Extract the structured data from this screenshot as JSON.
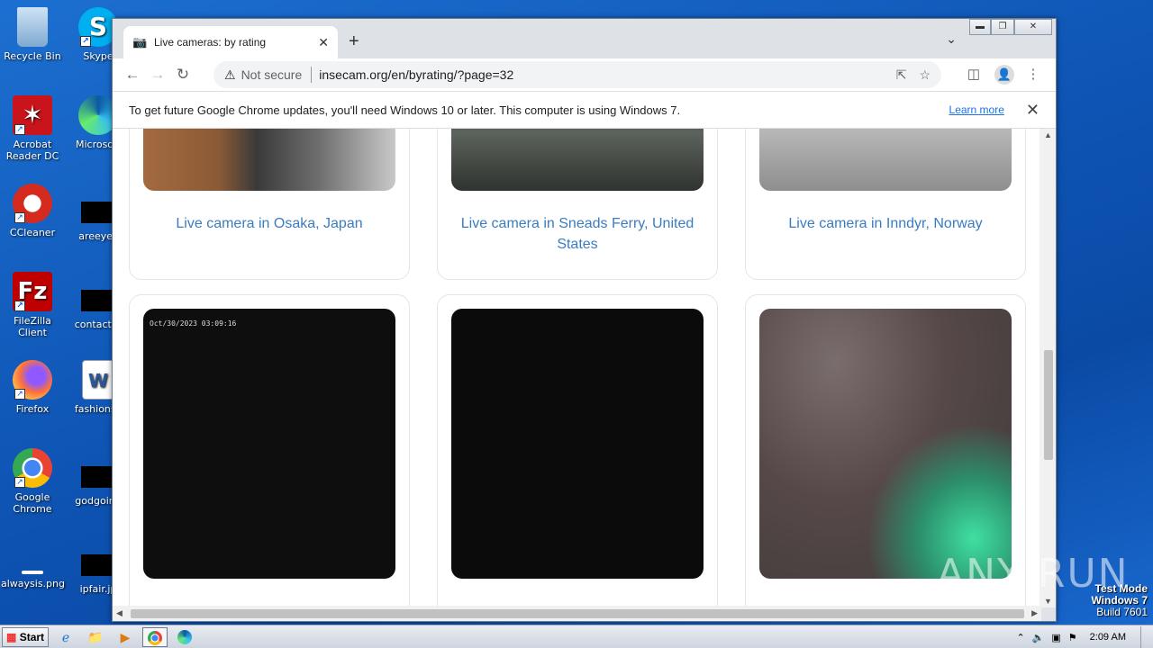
{
  "desktop": {
    "icons": [
      {
        "label": "Recycle Bin",
        "icon": "recycle-bin-icon"
      },
      {
        "label": "Skype",
        "icon": "skype-icon"
      },
      {
        "label": "Acrobat Reader DC",
        "icon": "acrobat-icon"
      },
      {
        "label": "Microsoft",
        "icon": "edge-icon"
      },
      {
        "label": "CCleaner",
        "icon": "ccleaner-icon"
      },
      {
        "label": "areeyes",
        "icon": "file-icon"
      },
      {
        "label": "FileZilla Client",
        "icon": "filezilla-icon"
      },
      {
        "label": "contactfri",
        "icon": "file-icon"
      },
      {
        "label": "Firefox",
        "icon": "firefox-icon"
      },
      {
        "label": "fashionsy",
        "icon": "word-icon"
      },
      {
        "label": "Google Chrome",
        "icon": "chrome-icon"
      },
      {
        "label": "godgoing",
        "icon": "file-icon"
      },
      {
        "label": "alwaysis.png",
        "icon": "image-file-icon"
      },
      {
        "label": "ipfair.jp",
        "icon": "file-icon"
      }
    ]
  },
  "browser": {
    "tab_title": "Live cameras: by rating",
    "url": "insecam.org/en/byrating/?page=32",
    "security_label": "Not secure",
    "infobar_message": "To get future Google Chrome updates, you'll need Windows 10 or later. This computer is using Windows 7.",
    "infobar_link": "Learn more"
  },
  "cameras": [
    {
      "caption": "Live camera in Osaka, Japan"
    },
    {
      "caption": "Live camera in Sneads Ferry, United States"
    },
    {
      "caption": "Live camera in Inndyr, Norway"
    },
    {
      "caption": "",
      "timestamp": "Oct/30/2023  03:09:16"
    },
    {
      "caption": ""
    },
    {
      "caption": ""
    }
  ],
  "taskbar": {
    "start_label": "Start",
    "clock": "2:09 AM"
  },
  "watermark": {
    "line1": "Test Mode",
    "line2": "Windows 7",
    "line3": "Build 7601",
    "brand": "ANY RUN"
  }
}
